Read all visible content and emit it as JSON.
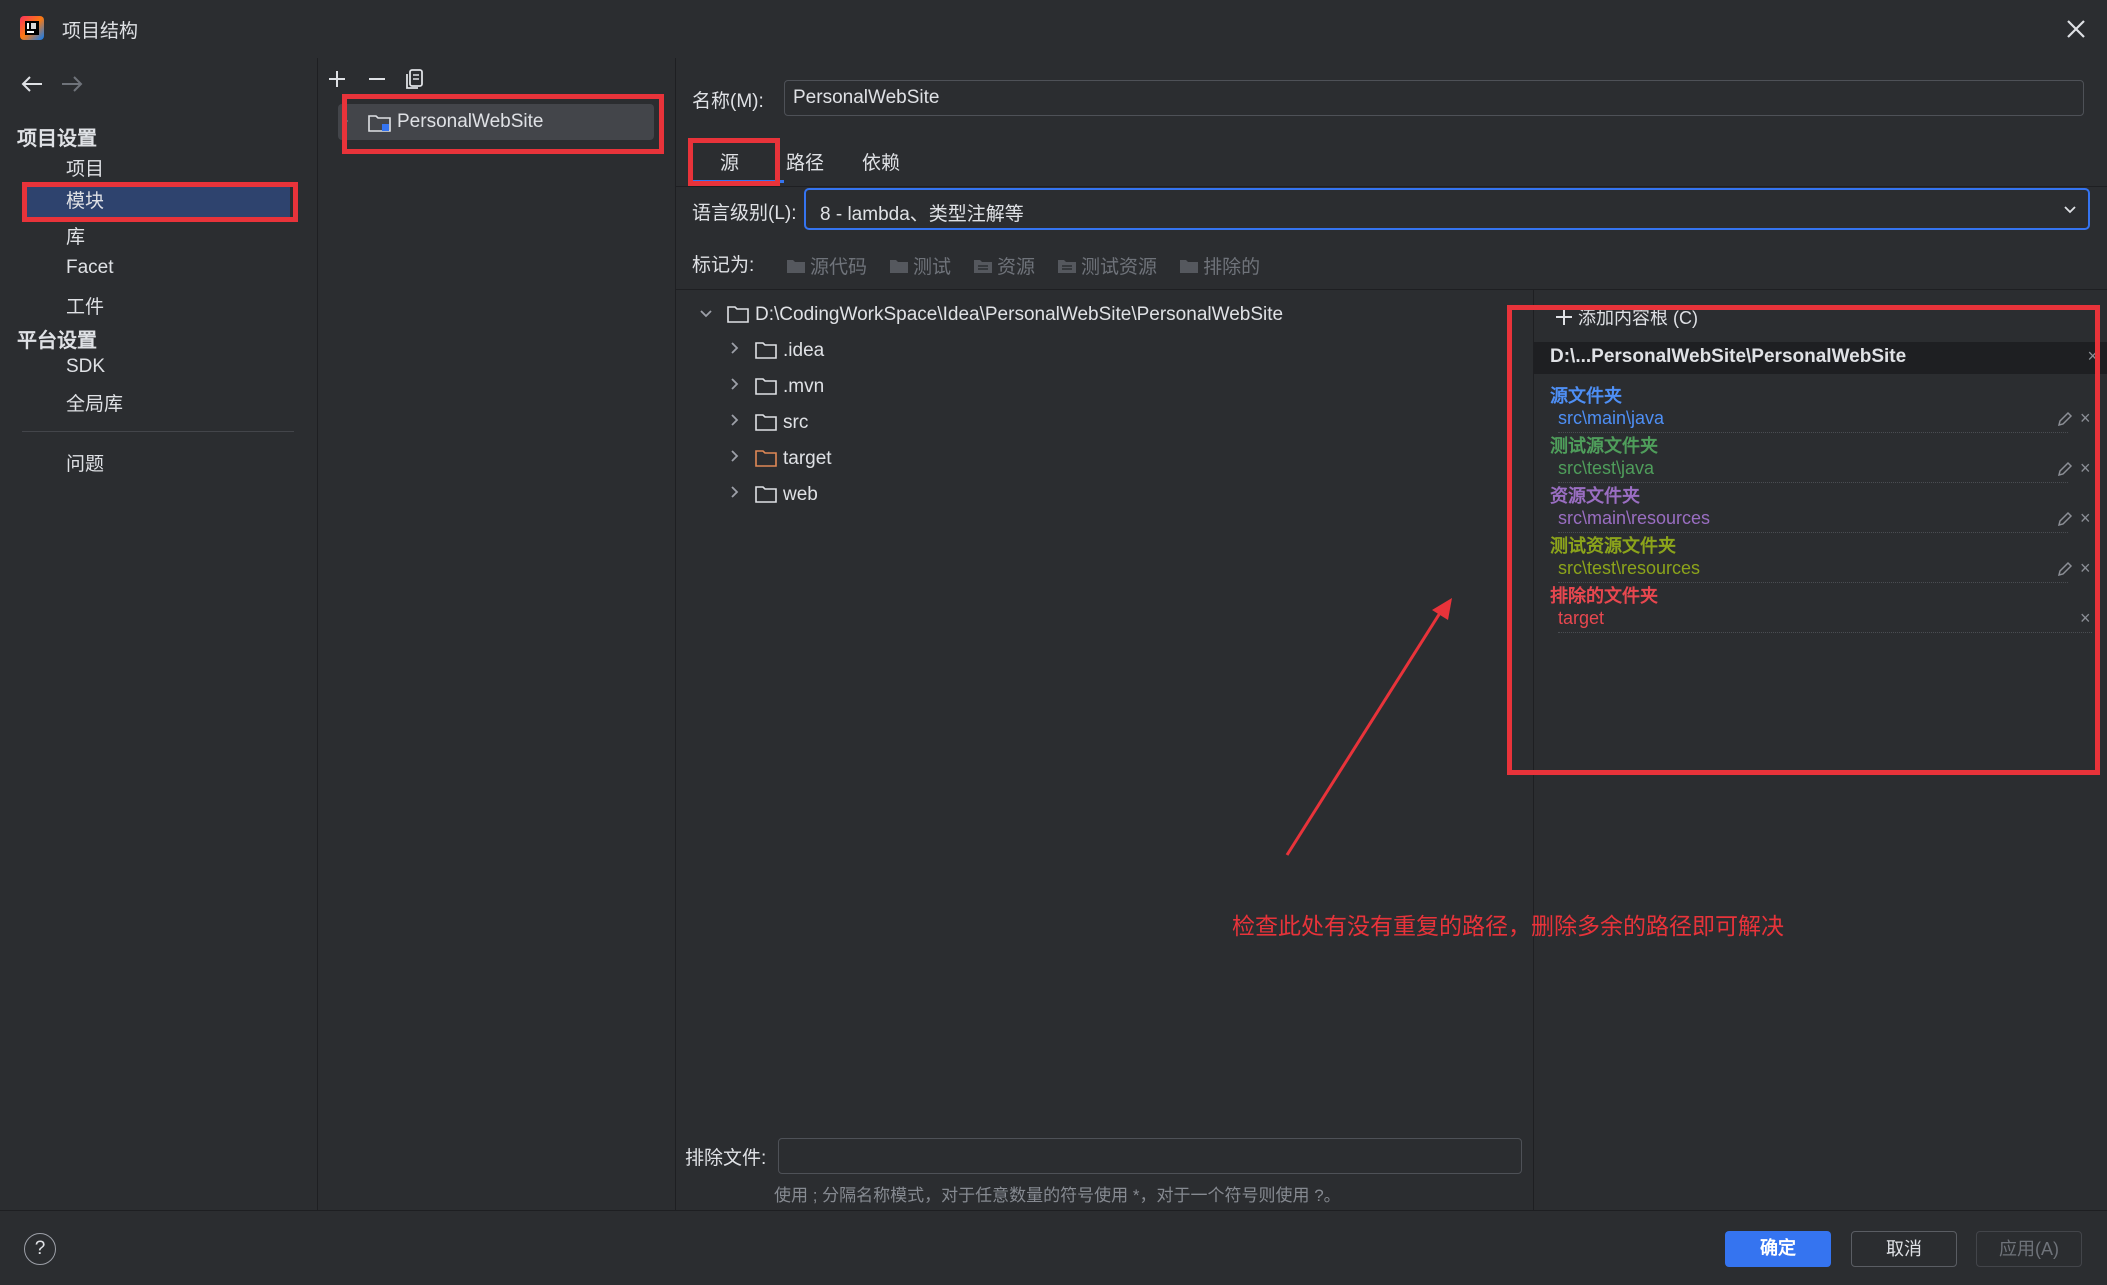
{
  "window": {
    "title": "项目结构"
  },
  "nav": {
    "project_settings": "项目设置",
    "items_project": [
      "项目",
      "模块",
      "库",
      "Facet",
      "工件"
    ],
    "platform_settings": "平台设置",
    "items_platform": [
      "SDK",
      "全局库"
    ],
    "problems": "问题"
  },
  "modules": {
    "items": [
      "PersonalWebSite"
    ]
  },
  "details": {
    "name_label": "名称(M):",
    "name_value": "PersonalWebSite",
    "tabs": [
      "源",
      "路径",
      "依赖"
    ],
    "active_tab": "源",
    "lang_level_label": "语言级别(L):",
    "lang_level_value": "8 - lambda、类型注解等",
    "mark_as_label": "标记为:",
    "mark_buttons": [
      "源代码",
      "测试",
      "资源",
      "测试资源",
      "排除的"
    ],
    "tree": {
      "root": "D:\\CodingWorkSpace\\Idea\\PersonalWebSite\\PersonalWebSite",
      "children": [
        ".idea",
        ".mvn",
        "src",
        "target",
        "web"
      ]
    },
    "exclude_files_label": "排除文件:",
    "exclude_files_value": "",
    "hint": "使用 ; 分隔名称模式，对于任意数量的符号使用 *，对于一个符号则使用 ?。"
  },
  "roots": {
    "add_label": "添加内容根 (C)",
    "root_path": "D:\\...PersonalWebSite\\PersonalWebSite",
    "groups": [
      {
        "title": "源文件夹",
        "path": "src\\main\\java",
        "color": "#4e8ff5"
      },
      {
        "title": "测试源文件夹",
        "path": "src\\test\\java",
        "color": "#4f9e5b"
      },
      {
        "title": "资源文件夹",
        "path": "src\\main\\resources",
        "color": "#9a6ec2"
      },
      {
        "title": "测试资源文件夹",
        "path": "src\\test\\resources",
        "color": "#8ca41b"
      },
      {
        "title": "排除的文件夹",
        "path": "target",
        "color": "#e8474f"
      }
    ]
  },
  "annotation": {
    "text": "检查此处有没有重复的路径，删除多余的路径即可解决",
    "color": "#e8333a"
  },
  "footer": {
    "ok": "确定",
    "cancel": "取消",
    "apply": "应用(A)"
  },
  "colors": {
    "accent": "#3574f0",
    "annotation_red": "#e8333a",
    "bg": "#2b2d30"
  }
}
